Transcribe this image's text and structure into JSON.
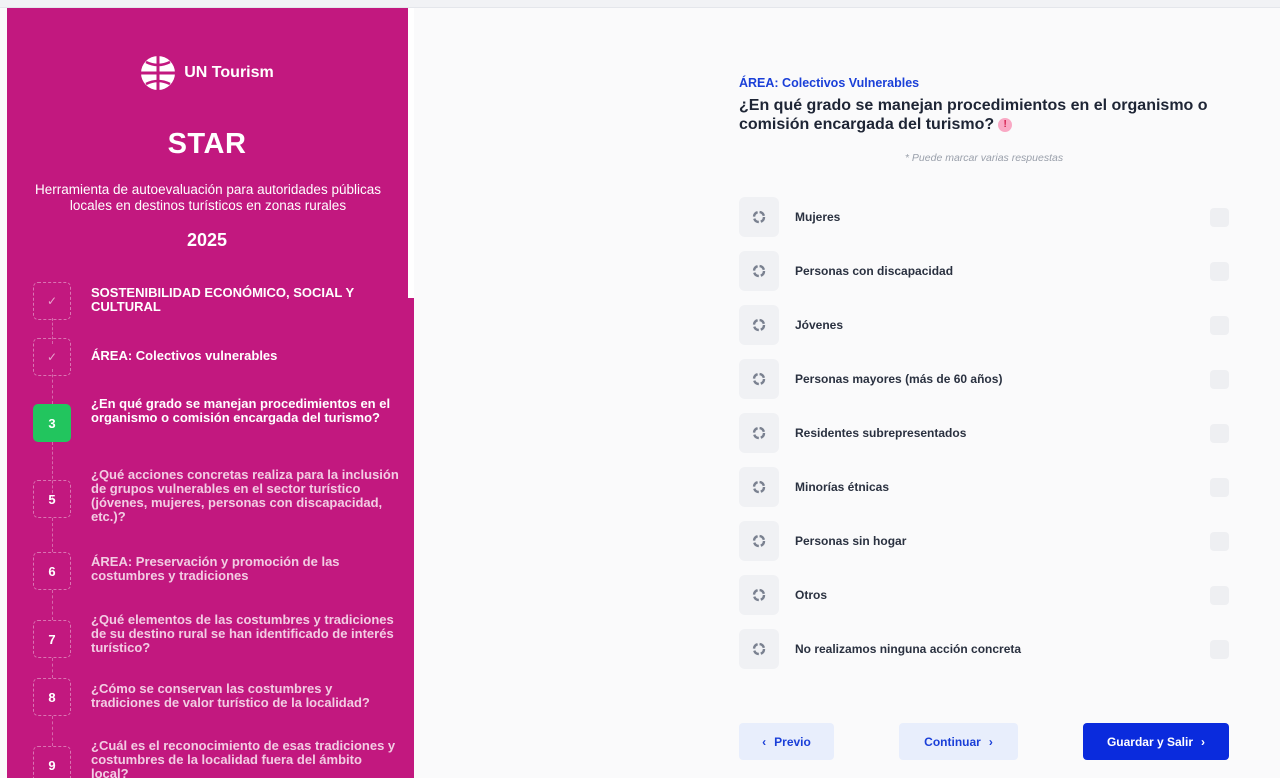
{
  "brand": {
    "org": "UN Tourism",
    "app_title": "STAR",
    "subtitle": "Herramienta de autoevaluación para autoridades públicas locales en destinos turísticos en zonas rurales",
    "year": "2025",
    "primary_color": "#c2187f"
  },
  "steps": [
    {
      "marker": "✓",
      "state": "done",
      "label": "SOSTENIBILIDAD ECONÓMICO, SOCIAL Y CULTURAL"
    },
    {
      "marker": "✓",
      "state": "done",
      "label": "ÁREA: Colectivos vulnerables"
    },
    {
      "marker": "3",
      "state": "active",
      "label": "¿En qué grado se manejan procedimientos en el organismo o comisión encargada del turismo?"
    },
    {
      "marker": "5",
      "state": "future",
      "label": "¿Qué acciones concretas realiza para la inclusión de grupos vulnerables en el sector turístico (jóvenes, mujeres, personas con discapacidad, etc.)?"
    },
    {
      "marker": "6",
      "state": "future",
      "label": "ÁREA: Preservación y promoción de las costumbres y tradiciones"
    },
    {
      "marker": "7",
      "state": "future",
      "label": "¿Qué elementos de las costumbres y tradiciones de su destino rural se han identificado de interés turístico?"
    },
    {
      "marker": "8",
      "state": "future",
      "label": "¿Cómo se conservan las costumbres y tradiciones de valor turístico de la localidad?"
    },
    {
      "marker": "9",
      "state": "future",
      "label": "¿Cuál es el reconocimiento de esas tradiciones y costumbres de la localidad fuera del ámbito local?"
    }
  ],
  "main": {
    "area": "ÁREA: Colectivos Vulnerables",
    "question": "¿En qué grado se manejan procedimientos en el organismo o comisión encargada del turismo?",
    "warning_icon": "!",
    "hint": "* Puede marcar varias respuestas",
    "options": [
      {
        "label": "Mujeres",
        "checked": false
      },
      {
        "label": "Personas con discapacidad",
        "checked": false
      },
      {
        "label": "Jóvenes",
        "checked": false
      },
      {
        "label": "Personas mayores (más de 60 años)",
        "checked": false
      },
      {
        "label": "Residentes subrepresentados",
        "checked": false
      },
      {
        "label": "Minorías étnicas",
        "checked": false
      },
      {
        "label": "Personas sin hogar",
        "checked": false
      },
      {
        "label": "Otros",
        "checked": false
      },
      {
        "label": "No realizamos ninguna acción concreta",
        "checked": false
      }
    ],
    "buttons": {
      "prev": "Previo",
      "prev_icon": "‹",
      "continue": "Continuar",
      "continue_icon": "›",
      "save": "Guardar y Salir",
      "save_icon": "›"
    },
    "accent_color": "#1a3fd8"
  }
}
